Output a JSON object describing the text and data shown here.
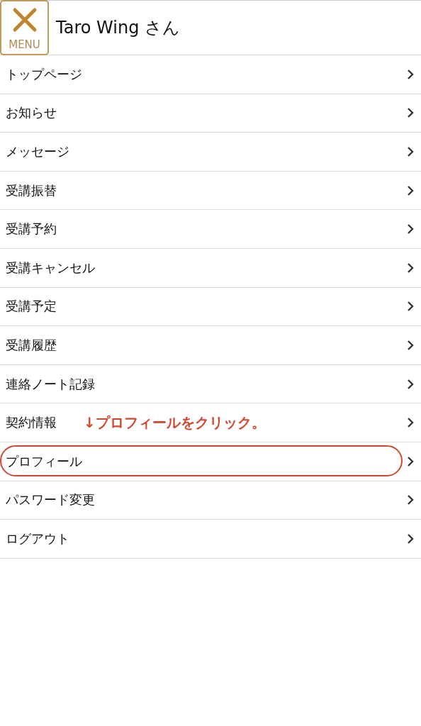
{
  "header": {
    "menu_label": "MENU",
    "user": "Taro Wing さん"
  },
  "menu": [
    {
      "label": "トップページ",
      "highlighted": false
    },
    {
      "label": "お知らせ",
      "highlighted": false
    },
    {
      "label": "メッセージ",
      "highlighted": false
    },
    {
      "label": "受講振替",
      "highlighted": false
    },
    {
      "label": "受講予約",
      "highlighted": false
    },
    {
      "label": "受講キャンセル",
      "highlighted": false
    },
    {
      "label": "受講予定",
      "highlighted": false
    },
    {
      "label": "受講履歴",
      "highlighted": false
    },
    {
      "label": "連絡ノート記録",
      "highlighted": false
    },
    {
      "label": "契約情報",
      "highlighted": false,
      "note": "↓プロフィールをクリック。"
    },
    {
      "label": "プロフィール",
      "highlighted": true
    },
    {
      "label": "パスワード変更",
      "highlighted": false
    },
    {
      "label": "ログアウト",
      "highlighted": false
    }
  ]
}
